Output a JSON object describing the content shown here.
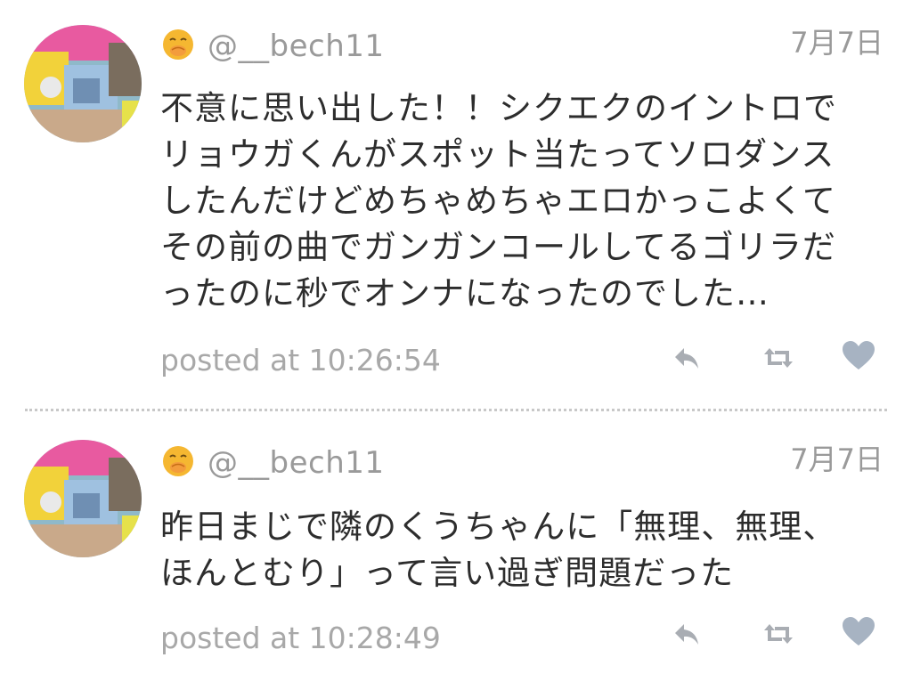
{
  "tweets": [
    {
      "handle": "@__bech11",
      "date": "7月7日",
      "lines": [
        "不意に思い出した！！シクエクのイントロで",
        "リョウガくんがスポット当たってソロダンス",
        "したんだけどめちゃめちゃエロかっこよくて",
        "その前の曲でガンガンコールしてるゴリラだ",
        "ったのに秒でオンナになったのでした…"
      ],
      "posted": "posted at 10:26:54",
      "emoji_icon": "hand-over-mouth-emoji-icon",
      "actions": [
        "reply-icon",
        "retweet-icon",
        "like-heart-icon"
      ]
    },
    {
      "handle": "@__bech11",
      "date": "7月7日",
      "lines": [
        "昨日まじで隣のくうちゃんに「無理、無理、",
        "ほんとむり」って言い過ぎ問題だった"
      ],
      "posted": "posted at 10:28:49",
      "emoji_icon": "hand-over-mouth-emoji-icon",
      "actions": [
        "reply-icon",
        "retweet-icon",
        "like-heart-icon"
      ]
    }
  ],
  "colors": {
    "meta_gray": "#9a9a9a",
    "icon_gray": "#a9adb3",
    "heart_blue_gray": "#a7b3c2",
    "emoji_yellow": "#f5b731",
    "divider": "#c8c8c8"
  }
}
